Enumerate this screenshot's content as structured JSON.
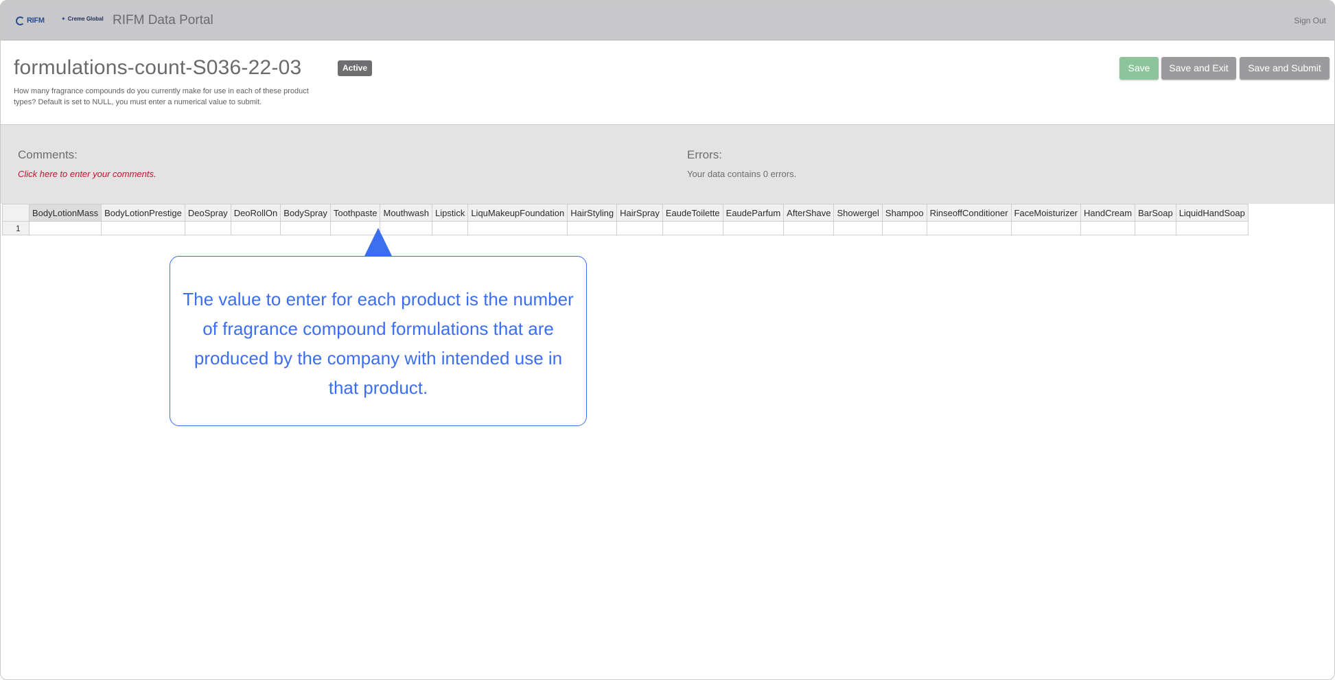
{
  "header": {
    "logo_rifm": "RIFM",
    "logo_creme": "Creme Global",
    "portal_title": "RIFM Data Portal",
    "sign_out": "Sign Out"
  },
  "page": {
    "title": "formulations-count-S036-22-03",
    "status": "Active",
    "description": "How many fragrance compounds do you currently make for use in each of these product types? Default is set to NULL, you must enter a numerical value to submit."
  },
  "actions": {
    "save": "Save",
    "save_exit": "Save and Exit",
    "save_submit": "Save and Submit"
  },
  "comments": {
    "title": "Comments:",
    "link": "Click here to enter your comments."
  },
  "errors": {
    "title": "Errors:",
    "text": "Your data contains 0 errors."
  },
  "grid": {
    "columns": [
      "BodyLotionMass",
      "BodyLotionPrestige",
      "DeoSpray",
      "DeoRollOn",
      "BodySpray",
      "Toothpaste",
      "Mouthwash",
      "Lipstick",
      "LiquMakeupFoundation",
      "HairStyling",
      "HairSpray",
      "EaudeToilette",
      "EaudeParfum",
      "AfterShave",
      "Showergel",
      "Shampoo",
      "RinseoffConditioner",
      "FaceMoisturizer",
      "HandCream",
      "BarSoap",
      "LiquidHandSoap"
    ],
    "row_label": "1"
  },
  "callout": {
    "text": "The value to enter for each product is the number of fragrance compound formulations that are produced by the company with intended use in that product."
  },
  "colors": {
    "accent": "#3c6ef2",
    "save_button": "#8cc49b",
    "secondary_button": "#9b9b9e",
    "comment_link": "#c8102e"
  }
}
